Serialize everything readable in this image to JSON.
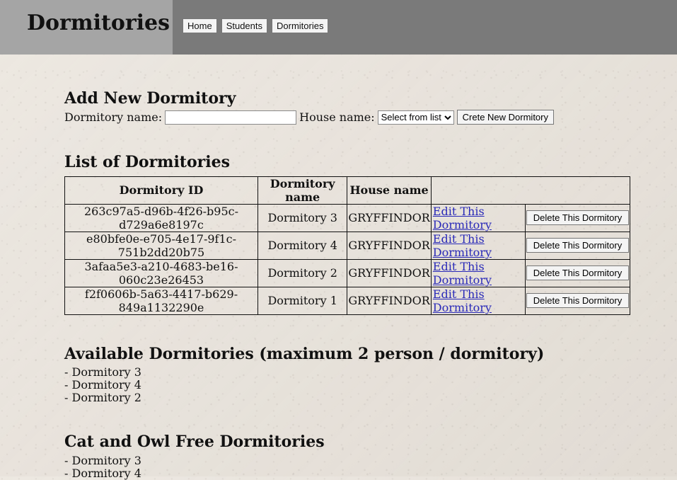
{
  "header": {
    "title": "Dormitories",
    "nav": [
      "Home",
      "Students",
      "Dormitories"
    ]
  },
  "add_section": {
    "title": "Add New Dormitory",
    "dormitory_label": "Dormitory name:",
    "dormitory_value": "",
    "house_label": "House name:",
    "house_selected": "Select from list",
    "create_button": "Crete New Dormitory"
  },
  "list_section": {
    "title": "List of Dormitories",
    "headers": [
      "Dormitory ID",
      "Dormitory name",
      "House name",
      ""
    ],
    "rows": [
      {
        "id": "263c97a5-d96b-4f26-b95c-d729a6e8197c",
        "name": "Dormitory 3",
        "house": "GRYFFINDOR",
        "edit": "Edit This Dormitory",
        "delete": "Delete This Dormitory"
      },
      {
        "id": "e80bfe0e-e705-4e17-9f1c-751b2dd20b75",
        "name": "Dormitory 4",
        "house": "GRYFFINDOR",
        "edit": "Edit This Dormitory",
        "delete": "Delete This Dormitory"
      },
      {
        "id": "3afaa5e3-a210-4683-be16-060c23e26453",
        "name": "Dormitory 2",
        "house": "GRYFFINDOR",
        "edit": "Edit This Dormitory",
        "delete": "Delete This Dormitory"
      },
      {
        "id": "f2f0606b-5a63-4417-b629-849a1132290e",
        "name": "Dormitory 1",
        "house": "GRYFFINDOR",
        "edit": "Edit This Dormitory",
        "delete": "Delete This Dormitory"
      }
    ]
  },
  "available_section": {
    "title": "Available Dormitories (maximum 2 person / dormitory)",
    "items": [
      "- Dormitory 3",
      "- Dormitory 4",
      "- Dormitory 2"
    ]
  },
  "cat_owl_section": {
    "title": "Cat and Owl Free Dormitories",
    "items": [
      "- Dormitory 3",
      "- Dormitory 4"
    ]
  }
}
